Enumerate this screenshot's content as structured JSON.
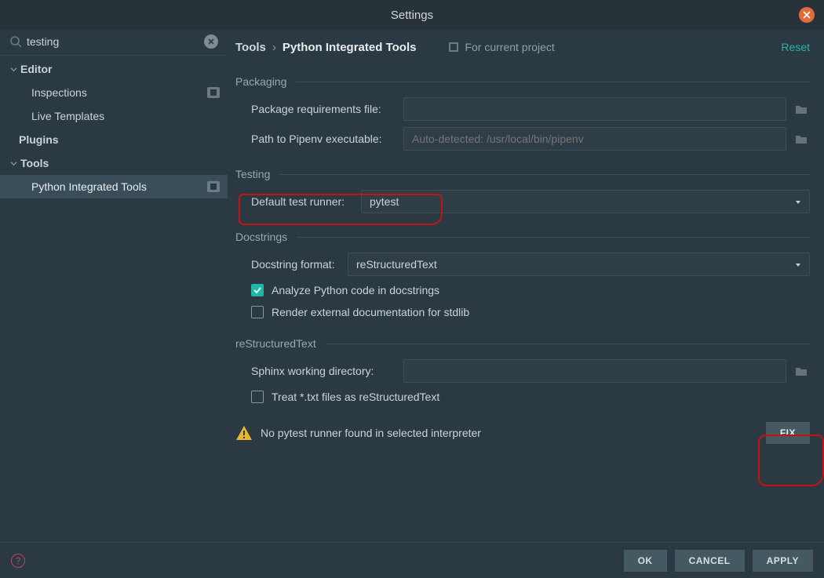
{
  "title": "Settings",
  "search_value": "testing",
  "reset_label": "Reset",
  "for_current_project_label": "For current project",
  "breadcrumb": {
    "item1": "Tools",
    "item2": "Python Integrated Tools"
  },
  "sidebar": {
    "items": [
      {
        "label": "Editor",
        "bold": true,
        "chevron": true,
        "indent": 0,
        "badge": false
      },
      {
        "label": "Inspections",
        "bold": false,
        "chevron": false,
        "indent": 2,
        "badge": true
      },
      {
        "label": "Live Templates",
        "bold": false,
        "chevron": false,
        "indent": 2,
        "badge": false
      },
      {
        "label": "Plugins",
        "bold": true,
        "chevron": false,
        "indent": 1,
        "badge": false
      },
      {
        "label": "Tools",
        "bold": true,
        "chevron": true,
        "indent": 0,
        "badge": false
      },
      {
        "label": "Python Integrated Tools",
        "bold": false,
        "chevron": false,
        "indent": 2,
        "badge": true,
        "selected": true
      }
    ]
  },
  "sections": {
    "packaging": {
      "title": "Packaging",
      "req_label": "Package requirements file:",
      "req_value": "",
      "pipenv_label": "Path to Pipenv executable:",
      "pipenv_placeholder": "Auto-detected: /usr/local/bin/pipenv"
    },
    "testing": {
      "title": "Testing",
      "runner_label": "Default test runner:",
      "runner_value": "pytest"
    },
    "docstrings": {
      "title": "Docstrings",
      "format_label": "Docstring format:",
      "format_value": "reStructuredText",
      "analyze_label": "Analyze Python code in docstrings",
      "analyze_checked": true,
      "render_label": "Render external documentation for stdlib",
      "render_checked": false
    },
    "rst": {
      "title": "reStructuredText",
      "sphinx_label": "Sphinx working directory:",
      "sphinx_value": "",
      "txt_label": "Treat *.txt files as reStructuredText",
      "txt_checked": false
    }
  },
  "warning": {
    "text": "No pytest runner found in selected interpreter",
    "fix_label": "FIX"
  },
  "footer": {
    "ok": "OK",
    "cancel": "CANCEL",
    "apply": "APPLY"
  }
}
